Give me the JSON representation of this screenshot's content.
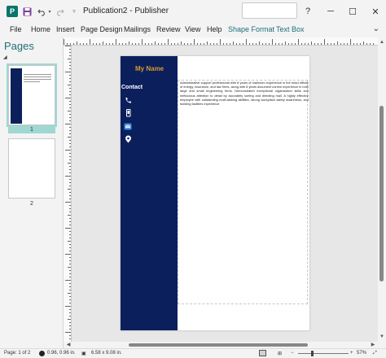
{
  "window": {
    "title": "Publication2 - Publisher",
    "app_icon_letter": "P",
    "help_glyph": "?",
    "minimize_glyph": "─",
    "maximize_glyph": "☐",
    "close_glyph": "✕"
  },
  "quick_access": {
    "save_icon": "save-icon",
    "undo_icon": "undo-icon",
    "redo_icon": "redo-icon",
    "customize_icon": "customize-quick-access-icon"
  },
  "menu": {
    "items": [
      "File",
      "Home",
      "Insert",
      "Page Design",
      "Mailings",
      "Review",
      "View",
      "Help",
      "Shape Format",
      "Text Box"
    ],
    "collapse_glyph": "⌄"
  },
  "pages_pane": {
    "title": "Pages",
    "pages": [
      {
        "label": "1",
        "selected": true
      },
      {
        "label": "2",
        "selected": false
      }
    ]
  },
  "document": {
    "name": "My Name",
    "contact_label": "Contact",
    "contact_icons": [
      "phone-icon",
      "mobile-icon",
      "email-icon",
      "location-icon"
    ],
    "body": "Administrative support professional with 8 years of mailroom experience in the head offices of energy, insurance, and law firms, along with 8 years document control experience in both large and small engineering firms. Demonstrated exceptional organization skills and meticulous attention to detail by accurately sorting and directing mail. A highly effective employee with outstanding multi-tasking abilities, strong workplace safety awareness, and building facilities experience",
    "colors": {
      "sidebar": "#0b1f5c",
      "name": "#d89a2a",
      "contact_text": "#ffffff"
    }
  },
  "status": {
    "page": "Page: 1 of 2",
    "position": "0.96, 0.96 in.",
    "size": "6.58 x 9.08 in.",
    "zoom": "57%",
    "zoom_minus": "−",
    "zoom_plus": "+"
  },
  "theme": {
    "accent": "#1f6f74",
    "page_selection": "#9fd7d3"
  }
}
